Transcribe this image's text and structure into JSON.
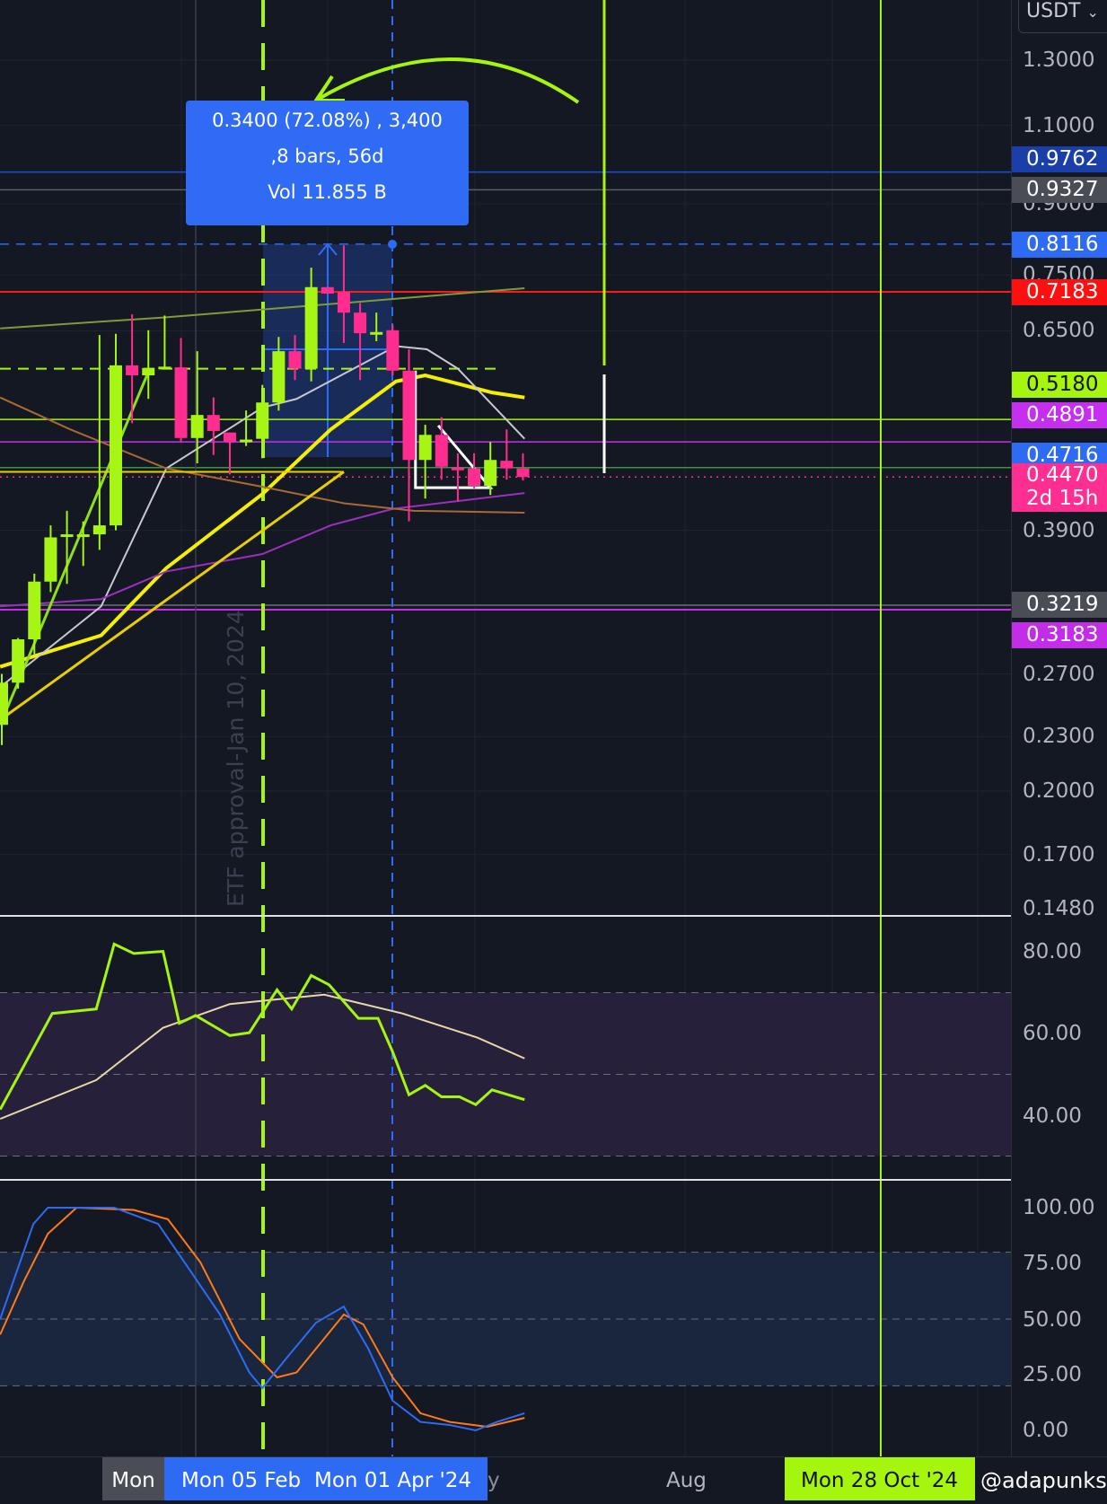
{
  "header": {
    "currency": "USDT"
  },
  "tooltip": {
    "line1": "0.3400 (72.08%) , 3,400",
    "line2": ",8 bars, 56d",
    "line3": "Vol 11.855 B"
  },
  "annotation": {
    "etf_text": "ETF approval-Jan 10, 2024"
  },
  "price_axis": {
    "labels": [
      "1.3000",
      "1.1000",
      "0.9000",
      "0.7500",
      "0.6500",
      "0.3900",
      "0.2700",
      "0.2300",
      "0.2000",
      "0.1700",
      "0.1480"
    ],
    "tags": [
      {
        "value": "0.9762",
        "color": "#1a3fa8"
      },
      {
        "value": "0.9327",
        "color": "#4a4d55"
      },
      {
        "value": "0.8116",
        "color": "#2e6bf5"
      },
      {
        "value": "0.7183",
        "color": "#ff1010"
      },
      {
        "value": "0.5180",
        "color": "#a5f50f"
      },
      {
        "value": "0.4891",
        "color": "#c62ff0"
      },
      {
        "value": "0.4716",
        "color": "#2e6bf5"
      },
      {
        "value": "0.4470",
        "color": "#ff2f92"
      },
      {
        "value": "0.3219",
        "color": "#4a4d55"
      },
      {
        "value": "0.3183",
        "color": "#c42de8"
      }
    ],
    "countdown": "2d 15h"
  },
  "rsi_axis": [
    "80.00",
    "60.00",
    "40.00"
  ],
  "stoch_axis": [
    "100.00",
    "75.00",
    "50.00",
    "25.00",
    "0.00"
  ],
  "time_axis": {
    "mon": "Mon",
    "feb": "Mon 05 Feb",
    "apr": "Mon 01 Apr '24",
    "may": "y",
    "aug": "Aug",
    "oct": "Mon 28 Oct '24",
    "watermark": "@adapunks"
  },
  "colors": {
    "up": "#a6f514",
    "down": "#ff2d8f",
    "background": "#141822"
  },
  "chart_data": {
    "type": "candlestick",
    "timeframe": "weekly",
    "candles_ohlc": [
      [
        0.237,
        0.27,
        0.225,
        0.264
      ],
      [
        0.264,
        0.296,
        0.26,
        0.295
      ],
      [
        0.295,
        0.349,
        0.284,
        0.342
      ],
      [
        0.342,
        0.395,
        0.333,
        0.383
      ],
      [
        0.384,
        0.41,
        0.34,
        0.386
      ],
      [
        0.385,
        0.399,
        0.356,
        0.386
      ],
      [
        0.386,
        0.643,
        0.371,
        0.395
      ],
      [
        0.395,
        0.645,
        0.39,
        0.595
      ],
      [
        0.595,
        0.678,
        0.513,
        0.58
      ],
      [
        0.58,
        0.651,
        0.546,
        0.591
      ],
      [
        0.592,
        0.676,
        0.589,
        0.593
      ],
      [
        0.592,
        0.638,
        0.489,
        0.494
      ],
      [
        0.494,
        0.617,
        0.463,
        0.524
      ],
      [
        0.524,
        0.548,
        0.473,
        0.503
      ],
      [
        0.501,
        0.501,
        0.45,
        0.489
      ],
      [
        0.491,
        0.53,
        0.484,
        0.492
      ],
      [
        0.493,
        0.566,
        0.469,
        0.541
      ],
      [
        0.541,
        0.64,
        0.53,
        0.617
      ],
      [
        0.617,
        0.643,
        0.573,
        0.59
      ],
      [
        0.59,
        0.764,
        0.571,
        0.727
      ],
      [
        0.727,
        0.727,
        0.715,
        0.715
      ],
      [
        0.718,
        0.809,
        0.63,
        0.681
      ],
      [
        0.681,
        0.698,
        0.573,
        0.646
      ],
      [
        0.647,
        0.681,
        0.633,
        0.648
      ],
      [
        0.651,
        0.66,
        0.58,
        0.587
      ],
      [
        0.587,
        0.62,
        0.399,
        0.467
      ],
      [
        0.467,
        0.511,
        0.423,
        0.498
      ],
      [
        0.498,
        0.521,
        0.444,
        0.459
      ],
      [
        0.458,
        0.475,
        0.42,
        0.457
      ],
      [
        0.457,
        0.475,
        0.434,
        0.437
      ],
      [
        0.437,
        0.489,
        0.427,
        0.467
      ],
      [
        0.466,
        0.505,
        0.444,
        0.457
      ],
      [
        0.457,
        0.475,
        0.443,
        0.447
      ]
    ],
    "moving_averages": [
      {
        "name": "ma-yellow",
        "color": "#f5f000",
        "points": [
          [
            -0.1,
            0.275
          ],
          [
            6.1,
            0.298
          ],
          [
            10.1,
            0.354
          ],
          [
            16,
            0.428
          ],
          [
            20.2,
            0.505
          ],
          [
            24.2,
            0.571
          ],
          [
            26,
            0.58
          ],
          [
            30.1,
            0.555
          ],
          [
            32.1,
            0.548
          ]
        ]
      },
      {
        "name": "ma-white",
        "color": "#c8c8d0",
        "points": [
          [
            -0.1,
            0.261
          ],
          [
            6.1,
            0.321
          ],
          [
            10.1,
            0.457
          ],
          [
            16,
            0.534
          ],
          [
            18.1,
            0.546
          ],
          [
            24.2,
            0.625
          ],
          [
            26.1,
            0.62
          ],
          [
            28,
            0.59
          ],
          [
            32.1,
            0.493
          ]
        ]
      },
      {
        "name": "ma-purple",
        "color": "#9b2fc0",
        "points": [
          [
            -0.1,
            0.321
          ],
          [
            6.1,
            0.327
          ],
          [
            10.1,
            0.351
          ],
          [
            16,
            0.367
          ],
          [
            20.2,
            0.395
          ],
          [
            24,
            0.412
          ],
          [
            32.1,
            0.429
          ]
        ]
      },
      {
        "name": "ma-orange",
        "color": "#a86a35",
        "points": [
          [
            -0.1,
            0.548
          ],
          [
            4.2,
            0.505
          ],
          [
            10.1,
            0.457
          ],
          [
            16,
            0.436
          ],
          [
            21,
            0.418
          ],
          [
            25.3,
            0.41
          ],
          [
            32.1,
            0.408
          ]
        ]
      },
      {
        "name": "ma-olive",
        "color": "#7f9a3a",
        "points": [
          [
            -0.1,
            0.654
          ],
          [
            10.1,
            0.673
          ],
          [
            21,
            0.698
          ],
          [
            32.1,
            0.725
          ]
        ]
      }
    ],
    "trendlines": [
      {
        "name": "green-trend",
        "color": "#8ee01a",
        "points": [
          [
            -0.1,
            0.237
          ],
          [
            9,
            0.585
          ]
        ]
      },
      {
        "name": "yellow-trend",
        "color": "#e8d000",
        "points": [
          [
            -0.1,
            0.24
          ],
          [
            21,
            0.453
          ]
        ]
      }
    ],
    "horizontal_levels": [
      0.9762,
      0.9327,
      0.8116,
      0.7183,
      0.518,
      0.4891,
      0.458,
      0.447,
      0.3219,
      0.3183
    ],
    "price_scale": "log",
    "price_range": [
      0.148,
      1.3
    ],
    "rsi": {
      "range": [
        20,
        90
      ],
      "bands": [
        70,
        50,
        30
      ],
      "line": [
        [
          -0.1,
          41.4
        ],
        [
          3.1,
          64.9
        ],
        [
          5.8,
          66
        ],
        [
          6.9,
          81.9
        ],
        [
          8.1,
          79.6
        ],
        [
          9.9,
          80.1
        ],
        [
          10.9,
          62.5
        ],
        [
          11.9,
          64.4
        ],
        [
          14,
          59.5
        ],
        [
          15.2,
          60.2
        ],
        [
          16.9,
          70.7
        ],
        [
          17.8,
          66
        ],
        [
          19,
          74.2
        ],
        [
          20.1,
          71.9
        ],
        [
          21.9,
          63.7
        ],
        [
          23.1,
          63.7
        ],
        [
          24,
          55.5
        ],
        [
          25,
          45
        ],
        [
          26,
          47.3
        ],
        [
          27,
          44.5
        ],
        [
          28.1,
          44.5
        ],
        [
          29.1,
          42.6
        ],
        [
          30.1,
          46.2
        ],
        [
          32.1,
          43.8
        ]
      ],
      "ma": [
        [
          -0.1,
          39.1
        ],
        [
          5.8,
          48.6
        ],
        [
          9.9,
          61.4
        ],
        [
          14,
          67.2
        ],
        [
          19.8,
          69.5
        ],
        [
          24.6,
          64.9
        ],
        [
          29.2,
          59
        ],
        [
          32.1,
          53.9
        ]
      ]
    },
    "stoch": {
      "range": [
        0,
        100
      ],
      "bands": [
        80,
        50,
        20
      ],
      "k": [
        [
          -0.1,
          50
        ],
        [
          1.94,
          92.7
        ],
        [
          2.83,
          100
        ],
        [
          6.9,
          100
        ],
        [
          9.6,
          92.7
        ],
        [
          11.6,
          71.4
        ],
        [
          13.4,
          52
        ],
        [
          15.2,
          26
        ],
        [
          16,
          19
        ],
        [
          17.5,
          32.6
        ],
        [
          19.3,
          48.4
        ],
        [
          21,
          55.6
        ],
        [
          22.5,
          36.7
        ],
        [
          24,
          13.3
        ],
        [
          25.7,
          3.8
        ],
        [
          27.5,
          2.4
        ],
        [
          29.1,
          0
        ],
        [
          30.4,
          3.8
        ],
        [
          32.1,
          7.7
        ]
      ],
      "d": [
        [
          -0.1,
          43
        ],
        [
          1.36,
          67
        ],
        [
          2.83,
          88.3
        ],
        [
          4.59,
          100
        ],
        [
          8.1,
          99
        ],
        [
          10.2,
          94.8
        ],
        [
          12.2,
          75.4
        ],
        [
          14.6,
          41
        ],
        [
          16.9,
          23.8
        ],
        [
          18.1,
          26
        ],
        [
          21,
          52
        ],
        [
          22.2,
          47.6
        ],
        [
          24,
          23.8
        ],
        [
          25.7,
          7.7
        ],
        [
          27.5,
          3.8
        ],
        [
          29.8,
          1.6
        ],
        [
          32.1,
          5.6
        ]
      ]
    }
  }
}
